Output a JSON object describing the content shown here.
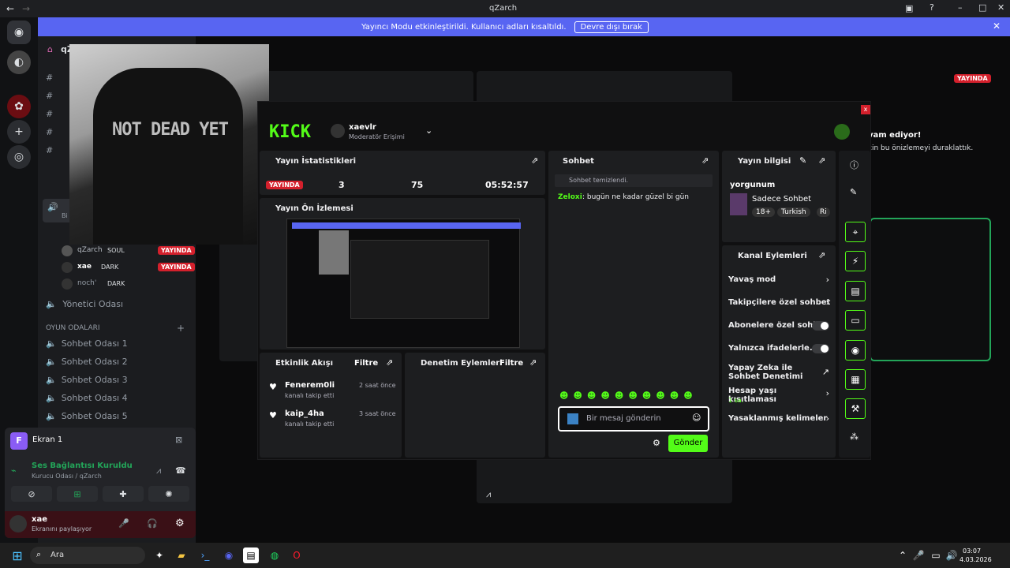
{
  "window": {
    "title": "qZarch"
  },
  "banner": {
    "text": "Yayıncı Modu etkinleştirildi. Kullanıcı adları kısaltıldı.",
    "button": "Devre dışı bırak"
  },
  "server": {
    "name": "qZ"
  },
  "channels": {
    "voice_users": [
      {
        "name": "qZarch",
        "tag": "SOUL",
        "badge": "YAYINDA"
      },
      {
        "name": "xae",
        "tag": "DARK",
        "badge": "YAYINDA"
      },
      {
        "name": "noch'",
        "tag": "DARK",
        "badge": ""
      }
    ],
    "admin_room": "Yönetici Odası",
    "category": "OYUN ODALARI",
    "rooms": [
      "Sohbet Odası 1",
      "Sohbet Odası 2",
      "Sohbet Odası 3",
      "Sohbet Odası 4",
      "Sohbet Odası 5"
    ],
    "partial": [
      "Bi"
    ]
  },
  "voice_panel": {
    "screen": "Ekran 1",
    "status": "Ses Bağlantısı Kuruldu",
    "location": "Kurucu Odası / qZarch",
    "user": "xae",
    "user_status": "Ekranını paylaşıyor"
  },
  "main": {
    "live_badge": "YAYINDA",
    "right_title": "vam ediyor!",
    "right_sub": "cin bu önizlemeyi duraklattık."
  },
  "kick": {
    "brand": "KICK",
    "user": "xaevlr",
    "role": "Moderatör Erişimi",
    "stats": {
      "title": "Yayın İstatistikleri",
      "live": "YAYINDA",
      "viewers": "3",
      "followers": "75",
      "time": "05:52:57"
    },
    "preview": {
      "title": "Yayın Ön İzlemesi",
      "poster_text": "NOT DEAD YET"
    },
    "activity": {
      "title": "Etkinlik Akışı",
      "filter": "Filtre",
      "items": [
        {
          "user": "Fenerem0li",
          "action": "kanalı takip etti",
          "time": "2 saat önce"
        },
        {
          "user": "kaip_4ha",
          "action": "kanalı takip etti",
          "time": "3 saat önce"
        }
      ]
    },
    "mod": {
      "title": "Denetim Eylemleri",
      "filter": "Filtre"
    },
    "chat": {
      "title": "Sohbet",
      "cleared": "Sohbet temizlendi.",
      "user": "Zeloxi",
      "message": ": bugün ne kadar güzel bi gün",
      "placeholder": "Bir mesaj gönderin",
      "send": "Gönder"
    },
    "info": {
      "title": "Yayın bilgisi",
      "stream_title": "yorgunum",
      "category": "Sadece Sohbet",
      "tags": [
        "18+",
        "Turkish",
        "Ri"
      ]
    },
    "actions": {
      "title": "Kanal Eylemleri",
      "items": [
        {
          "label": "Yavaş mod",
          "kind": "arrow"
        },
        {
          "label": "Takipçilere özel sohbet",
          "kind": "arrow"
        },
        {
          "label": "Abonelere özel sohbet",
          "kind": "toggle"
        },
        {
          "label": "Yalnızca ifadelerle...",
          "kind": "toggle"
        },
        {
          "label": "Yapay Zeka ile Sohbet Denetimi",
          "kind": "ext"
        },
        {
          "label": "Hesap yaşı kısıtlaması",
          "kind": "arrow",
          "sub": "1 sa."
        },
        {
          "label": "Yasaklanmış kelimeler",
          "kind": "arrow"
        }
      ]
    }
  },
  "taskbar": {
    "search": "Ara",
    "time": "03:07",
    "date": "4.03.2026"
  },
  "colors": {
    "kick_green": "#53fc18",
    "discord_blurple": "#5865f2",
    "live_red": "#d4202c"
  }
}
